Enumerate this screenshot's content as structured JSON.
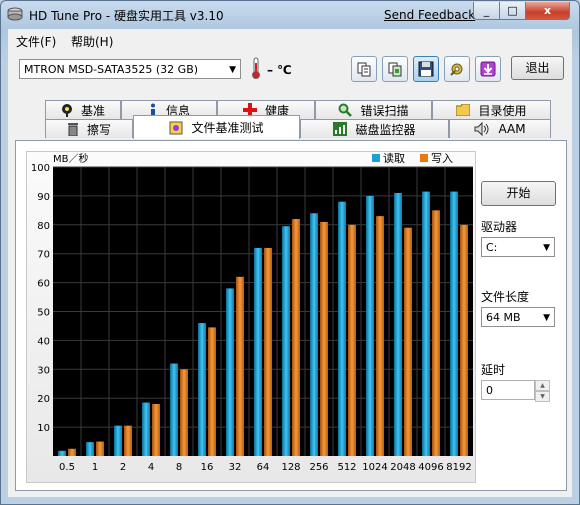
{
  "window": {
    "title": "HD Tune Pro - 硬盘实用工具 v3.10",
    "send_feedback": "Send Feedback",
    "min": "_",
    "max": "□",
    "close": "x"
  },
  "menu": {
    "file": "文件(F)",
    "help": "帮助(H)"
  },
  "toolbar": {
    "drive": "MTRON MSD-SATA3525 (32 GB)",
    "temperature": "– ℃",
    "exit": "退出",
    "buttons": [
      "copy-info-icon",
      "copy-screenshot-icon",
      "save-icon",
      "options-icon",
      "download-icon"
    ]
  },
  "tabs": {
    "row1": [
      "基准",
      "信息",
      "健康",
      "错误扫描",
      "目录使用"
    ],
    "row2": [
      "擦写",
      "文件基准测试",
      "磁盘监控器",
      "AAM"
    ],
    "active": "文件基准测试"
  },
  "side": {
    "start": "开始",
    "drive_label": "驱动器",
    "drive_value": "C:",
    "file_length_label": "文件长度",
    "file_length_value": "64 MB",
    "delay_label": "延时",
    "delay_value": "0"
  },
  "colors": {
    "read": "#1e9fd6",
    "write": "#e87a10",
    "plot_bg": "#000000"
  },
  "chart_data": {
    "type": "bar",
    "ylabel": "MB／秒",
    "ylim": [
      0,
      100
    ],
    "yticks": [
      10,
      20,
      30,
      40,
      50,
      60,
      70,
      80,
      90,
      100
    ],
    "categories": [
      "0.5",
      "1",
      "2",
      "4",
      "8",
      "16",
      "32",
      "64",
      "128",
      "256",
      "512",
      "1024",
      "2048",
      "4096",
      "8192"
    ],
    "series": [
      {
        "name": "读取",
        "values": [
          1.8,
          4.8,
          10.5,
          18.5,
          32,
          46,
          58,
          72,
          79.5,
          84,
          88,
          90,
          91,
          91.5,
          91.5
        ]
      },
      {
        "name": "写入",
        "values": [
          2.5,
          5,
          10.5,
          18,
          30,
          44.5,
          62,
          72,
          82,
          81,
          80,
          83,
          79,
          85,
          80
        ]
      }
    ],
    "grid": true,
    "legend": "top-right"
  }
}
